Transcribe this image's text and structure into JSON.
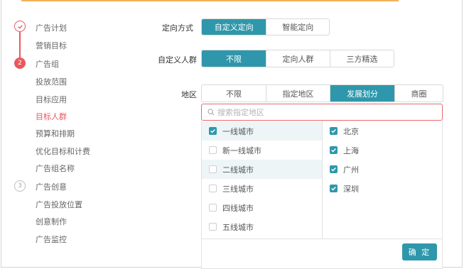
{
  "steps": [
    {
      "label": "广告计划",
      "state": "done",
      "icon": "check-icon"
    },
    {
      "label": "广告组",
      "state": "active",
      "number": "2"
    },
    {
      "label": "广告创意",
      "state": "pending",
      "number": "3"
    }
  ],
  "nav_items": {
    "marketing_goal": "营销目标",
    "delivery_scope": "投放范围",
    "target_app": "目标应用",
    "target_audience": "目标人群",
    "budget_schedule": "预算和排期",
    "optimize_billing": "优化目标和计费",
    "adgroup_name": "广告组名称",
    "placement": "广告投放位置",
    "creative_make": "创意制作",
    "ad_monitor": "广告监控"
  },
  "targeting_mode": {
    "label": "定向方式",
    "options": [
      "自定义定向",
      "智能定向"
    ],
    "selected": "自定义定向"
  },
  "custom_audience": {
    "label": "自定义人群",
    "options": [
      "不限",
      "定向人群",
      "三方精选"
    ],
    "selected": "不限"
  },
  "region": {
    "label": "地区",
    "options": [
      "不限",
      "指定地区",
      "发展划分",
      "商圈"
    ],
    "selected": "发展划分"
  },
  "search": {
    "placeholder": "搜索指定地区",
    "value": ""
  },
  "city_tiers": [
    {
      "label": "一线城市",
      "checked": true
    },
    {
      "label": "新一线城市",
      "checked": false
    },
    {
      "label": "二线城市",
      "checked": false
    },
    {
      "label": "三线城市",
      "checked": false
    },
    {
      "label": "四线城市",
      "checked": false
    },
    {
      "label": "五线城市",
      "checked": false
    }
  ],
  "cities": [
    {
      "label": "北京",
      "checked": true
    },
    {
      "label": "上海",
      "checked": true
    },
    {
      "label": "广州",
      "checked": true
    },
    {
      "label": "深圳",
      "checked": true
    }
  ],
  "confirm_label": "确 定",
  "colors": {
    "accent": "#2f97ab",
    "brand_red": "#e8595f",
    "highlight_row": "#eef5f6"
  }
}
